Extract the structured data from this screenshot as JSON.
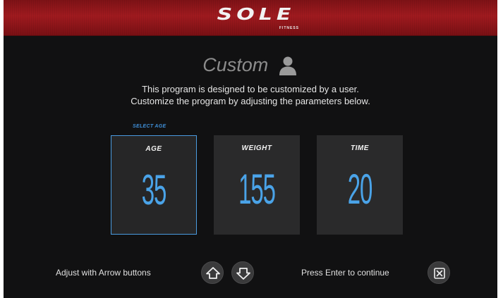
{
  "header": {
    "logo": "SOLE",
    "logo_sub": "FITNESS"
  },
  "program": {
    "title": "Custom",
    "description_line1": "This program is designed to be customized by a user.",
    "description_line2": "Customize the program by adjusting the parameters below."
  },
  "selector": {
    "label": "SELECT AGE",
    "selected": "age"
  },
  "params": {
    "age": {
      "label": "AGE",
      "value": "35"
    },
    "weight": {
      "label": "WEIGHT",
      "value": "155"
    },
    "time": {
      "label": "TIME",
      "value": "20"
    }
  },
  "footer": {
    "adjust_text": "Adjust with Arrow buttons",
    "enter_text": "Press Enter to continue"
  },
  "icons": {
    "user": "user-icon",
    "up": "arrow-up-icon",
    "down": "arrow-down-icon",
    "enter": "close-box-icon"
  },
  "colors": {
    "header_red": "#a01a1f",
    "accent_blue": "#4aa3e8",
    "background": "#111112",
    "panel": "#2a2a2b"
  }
}
